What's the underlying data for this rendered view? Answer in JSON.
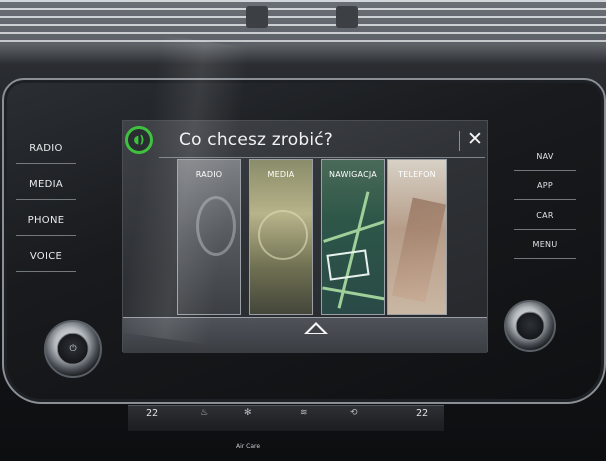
{
  "left_buttons": [
    "RADIO",
    "MEDIA",
    "PHONE",
    "VOICE"
  ],
  "right_buttons": [
    "NAV",
    "APP",
    "CAR",
    "MENU"
  ],
  "dialog": {
    "title": "Co chcesz zrobić?",
    "close_glyph": "✕",
    "mic_icon": "voice-control-icon"
  },
  "tiles": [
    "RADIO",
    "MEDIA",
    "NAWIGACJA",
    "TELEFON"
  ],
  "climate": {
    "temp_left": "22",
    "temp_right": "22",
    "air_care_label": "Air Care"
  },
  "colors": {
    "voice_accent": "#3ec13e",
    "screen_bg": "#2e3135",
    "text": "#ffffff"
  }
}
